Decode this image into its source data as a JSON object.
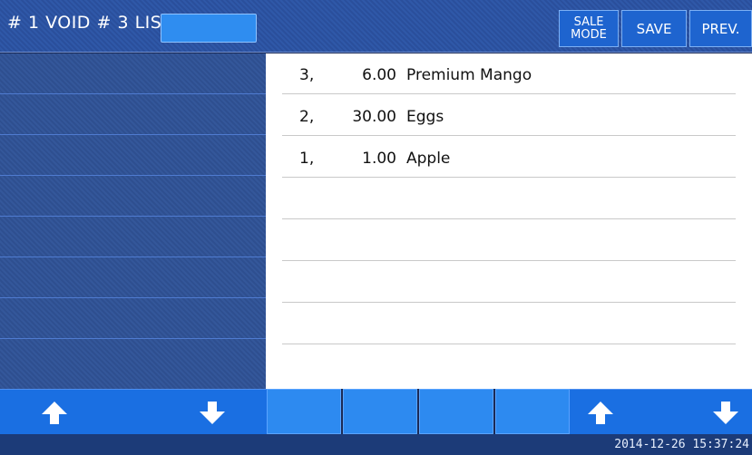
{
  "header": {
    "title": "# 1 VOID # 3  LIS",
    "input_value": "",
    "buttons": {
      "sale_mode": "SALE\nMODE",
      "save": "SAVE",
      "prev": "PREV."
    }
  },
  "list": {
    "rows": [
      {
        "index": "3,",
        "qty": "6.00",
        "name": "Premium Mango"
      },
      {
        "index": "2,",
        "qty": "30.00",
        "name": "Eggs"
      },
      {
        "index": "1,",
        "qty": "1.00",
        "name": "Apple"
      },
      {
        "index": "",
        "qty": "",
        "name": ""
      },
      {
        "index": "",
        "qty": "",
        "name": ""
      },
      {
        "index": "",
        "qty": "",
        "name": ""
      },
      {
        "index": "",
        "qty": "",
        "name": ""
      },
      {
        "index": "",
        "qty": "",
        "name": ""
      }
    ]
  },
  "icons": {
    "up": "arrow-up-icon",
    "down": "arrow-down-icon"
  },
  "colors": {
    "accent": "#1e64cf",
    "button_blue": "#2d8af0",
    "header_blue": "#2f58a8",
    "background": "#1b2a55"
  },
  "status": {
    "datetime": "2014-12-26 15:37:24"
  }
}
